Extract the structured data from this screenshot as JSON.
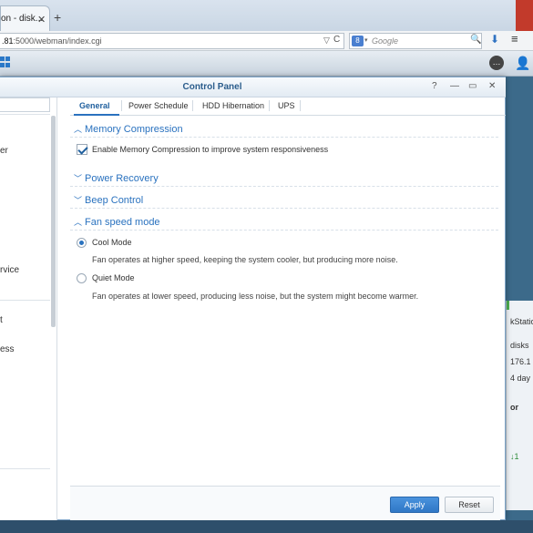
{
  "browser": {
    "tab_title": "on - disk...",
    "tab_close": "✕",
    "new_tab": "+",
    "url_host": ".81",
    "url_rest": ":5000/webman/index.cgi",
    "url_dropdown": "▽",
    "reload": "C",
    "search_engine": "8",
    "search_caret": "▾",
    "search_placeholder": "Google",
    "search_icon_glyph": "🔍",
    "download_glyph": "⬇",
    "menu_glyph": "≡"
  },
  "dsm": {
    "chat_glyph": "…",
    "user_glyph": "👤"
  },
  "window": {
    "title": "Control Panel",
    "help": "?",
    "minimize": "—",
    "maximize": "▭",
    "close": "✕"
  },
  "sidebar": {
    "items": [
      {
        "label": "er"
      },
      {
        "label": "rvice"
      },
      {
        "label": "t"
      },
      {
        "label": "ess"
      }
    ]
  },
  "tabs": [
    {
      "label": "General",
      "active": true
    },
    {
      "label": "Power Schedule",
      "active": false
    },
    {
      "label": "HDD Hibernation",
      "active": false
    },
    {
      "label": "UPS",
      "active": false
    }
  ],
  "sections": {
    "memory_compression": {
      "title": "Memory Compression",
      "expanded": true,
      "checkbox_label": "Enable Memory Compression to improve system responsiveness",
      "checked": true
    },
    "power_recovery": {
      "title": "Power Recovery",
      "expanded": false
    },
    "beep_control": {
      "title": "Beep Control",
      "expanded": false
    },
    "fan_speed": {
      "title": "Fan speed mode",
      "expanded": true,
      "options": [
        {
          "label": "Cool Mode",
          "selected": true,
          "description": "Fan operates at higher speed, keeping the system cooler, but producing more noise."
        },
        {
          "label": "Quiet Mode",
          "selected": false,
          "description": "Fan operates at lower speed, producing less noise, but the system might become warmer."
        }
      ]
    }
  },
  "footer": {
    "apply_label": "Apply",
    "reset_label": "Reset"
  },
  "desktop_widget": {
    "lines": [
      "kStation",
      "disks",
      "176.1",
      "4 day",
      "or",
      "↓1"
    ]
  },
  "colors": {
    "accent": "#2a72bf",
    "title_blue": "#2b5d8c",
    "apply_button": "#3b84d0"
  }
}
